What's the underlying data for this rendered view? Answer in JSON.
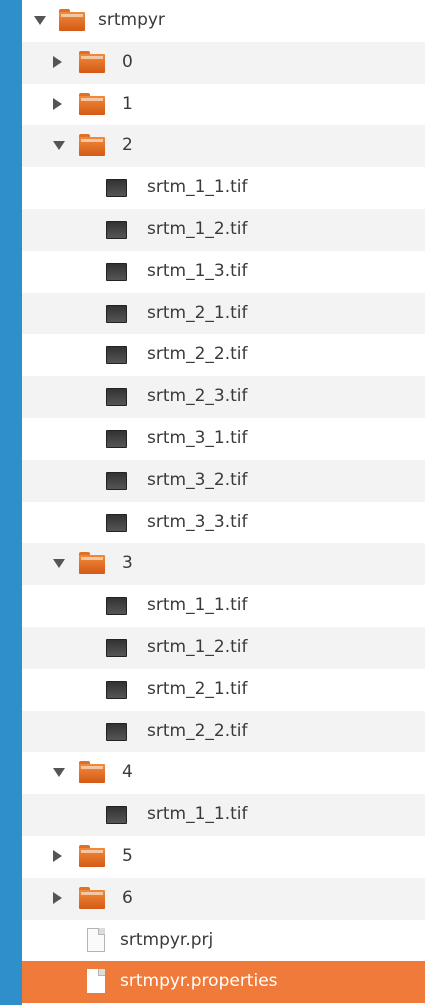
{
  "tree": [
    {
      "label": "srtmpyr",
      "type": "folder",
      "depth": 0,
      "expanded": true
    },
    {
      "label": "0",
      "type": "folder",
      "depth": 1,
      "expanded": false
    },
    {
      "label": "1",
      "type": "folder",
      "depth": 1,
      "expanded": false
    },
    {
      "label": "2",
      "type": "folder",
      "depth": 1,
      "expanded": true
    },
    {
      "label": "srtm_1_1.tif",
      "type": "tif",
      "depth": 2
    },
    {
      "label": "srtm_1_2.tif",
      "type": "tif",
      "depth": 2
    },
    {
      "label": "srtm_1_3.tif",
      "type": "tif",
      "depth": 2
    },
    {
      "label": "srtm_2_1.tif",
      "type": "tif",
      "depth": 2
    },
    {
      "label": "srtm_2_2.tif",
      "type": "tif",
      "depth": 2
    },
    {
      "label": "srtm_2_3.tif",
      "type": "tif",
      "depth": 2
    },
    {
      "label": "srtm_3_1.tif",
      "type": "tif",
      "depth": 2
    },
    {
      "label": "srtm_3_2.tif",
      "type": "tif",
      "depth": 2
    },
    {
      "label": "srtm_3_3.tif",
      "type": "tif",
      "depth": 2
    },
    {
      "label": "3",
      "type": "folder",
      "depth": 1,
      "expanded": true
    },
    {
      "label": "srtm_1_1.tif",
      "type": "tif",
      "depth": 2
    },
    {
      "label": "srtm_1_2.tif",
      "type": "tif",
      "depth": 2
    },
    {
      "label": "srtm_2_1.tif",
      "type": "tif",
      "depth": 2
    },
    {
      "label": "srtm_2_2.tif",
      "type": "tif",
      "depth": 2
    },
    {
      "label": "4",
      "type": "folder",
      "depth": 1,
      "expanded": true
    },
    {
      "label": "srtm_1_1.tif",
      "type": "tif",
      "depth": 2
    },
    {
      "label": "5",
      "type": "folder",
      "depth": 1,
      "expanded": false
    },
    {
      "label": "6",
      "type": "folder",
      "depth": 1,
      "expanded": false
    },
    {
      "label": "srtmpyr.prj",
      "type": "file",
      "depth": 1
    },
    {
      "label": "srtmpyr.properties",
      "type": "file",
      "depth": 1,
      "selected": true
    }
  ],
  "colors": {
    "background": "#2e8fcb",
    "selection": "#f07a3a",
    "folder": "#e97a30"
  }
}
